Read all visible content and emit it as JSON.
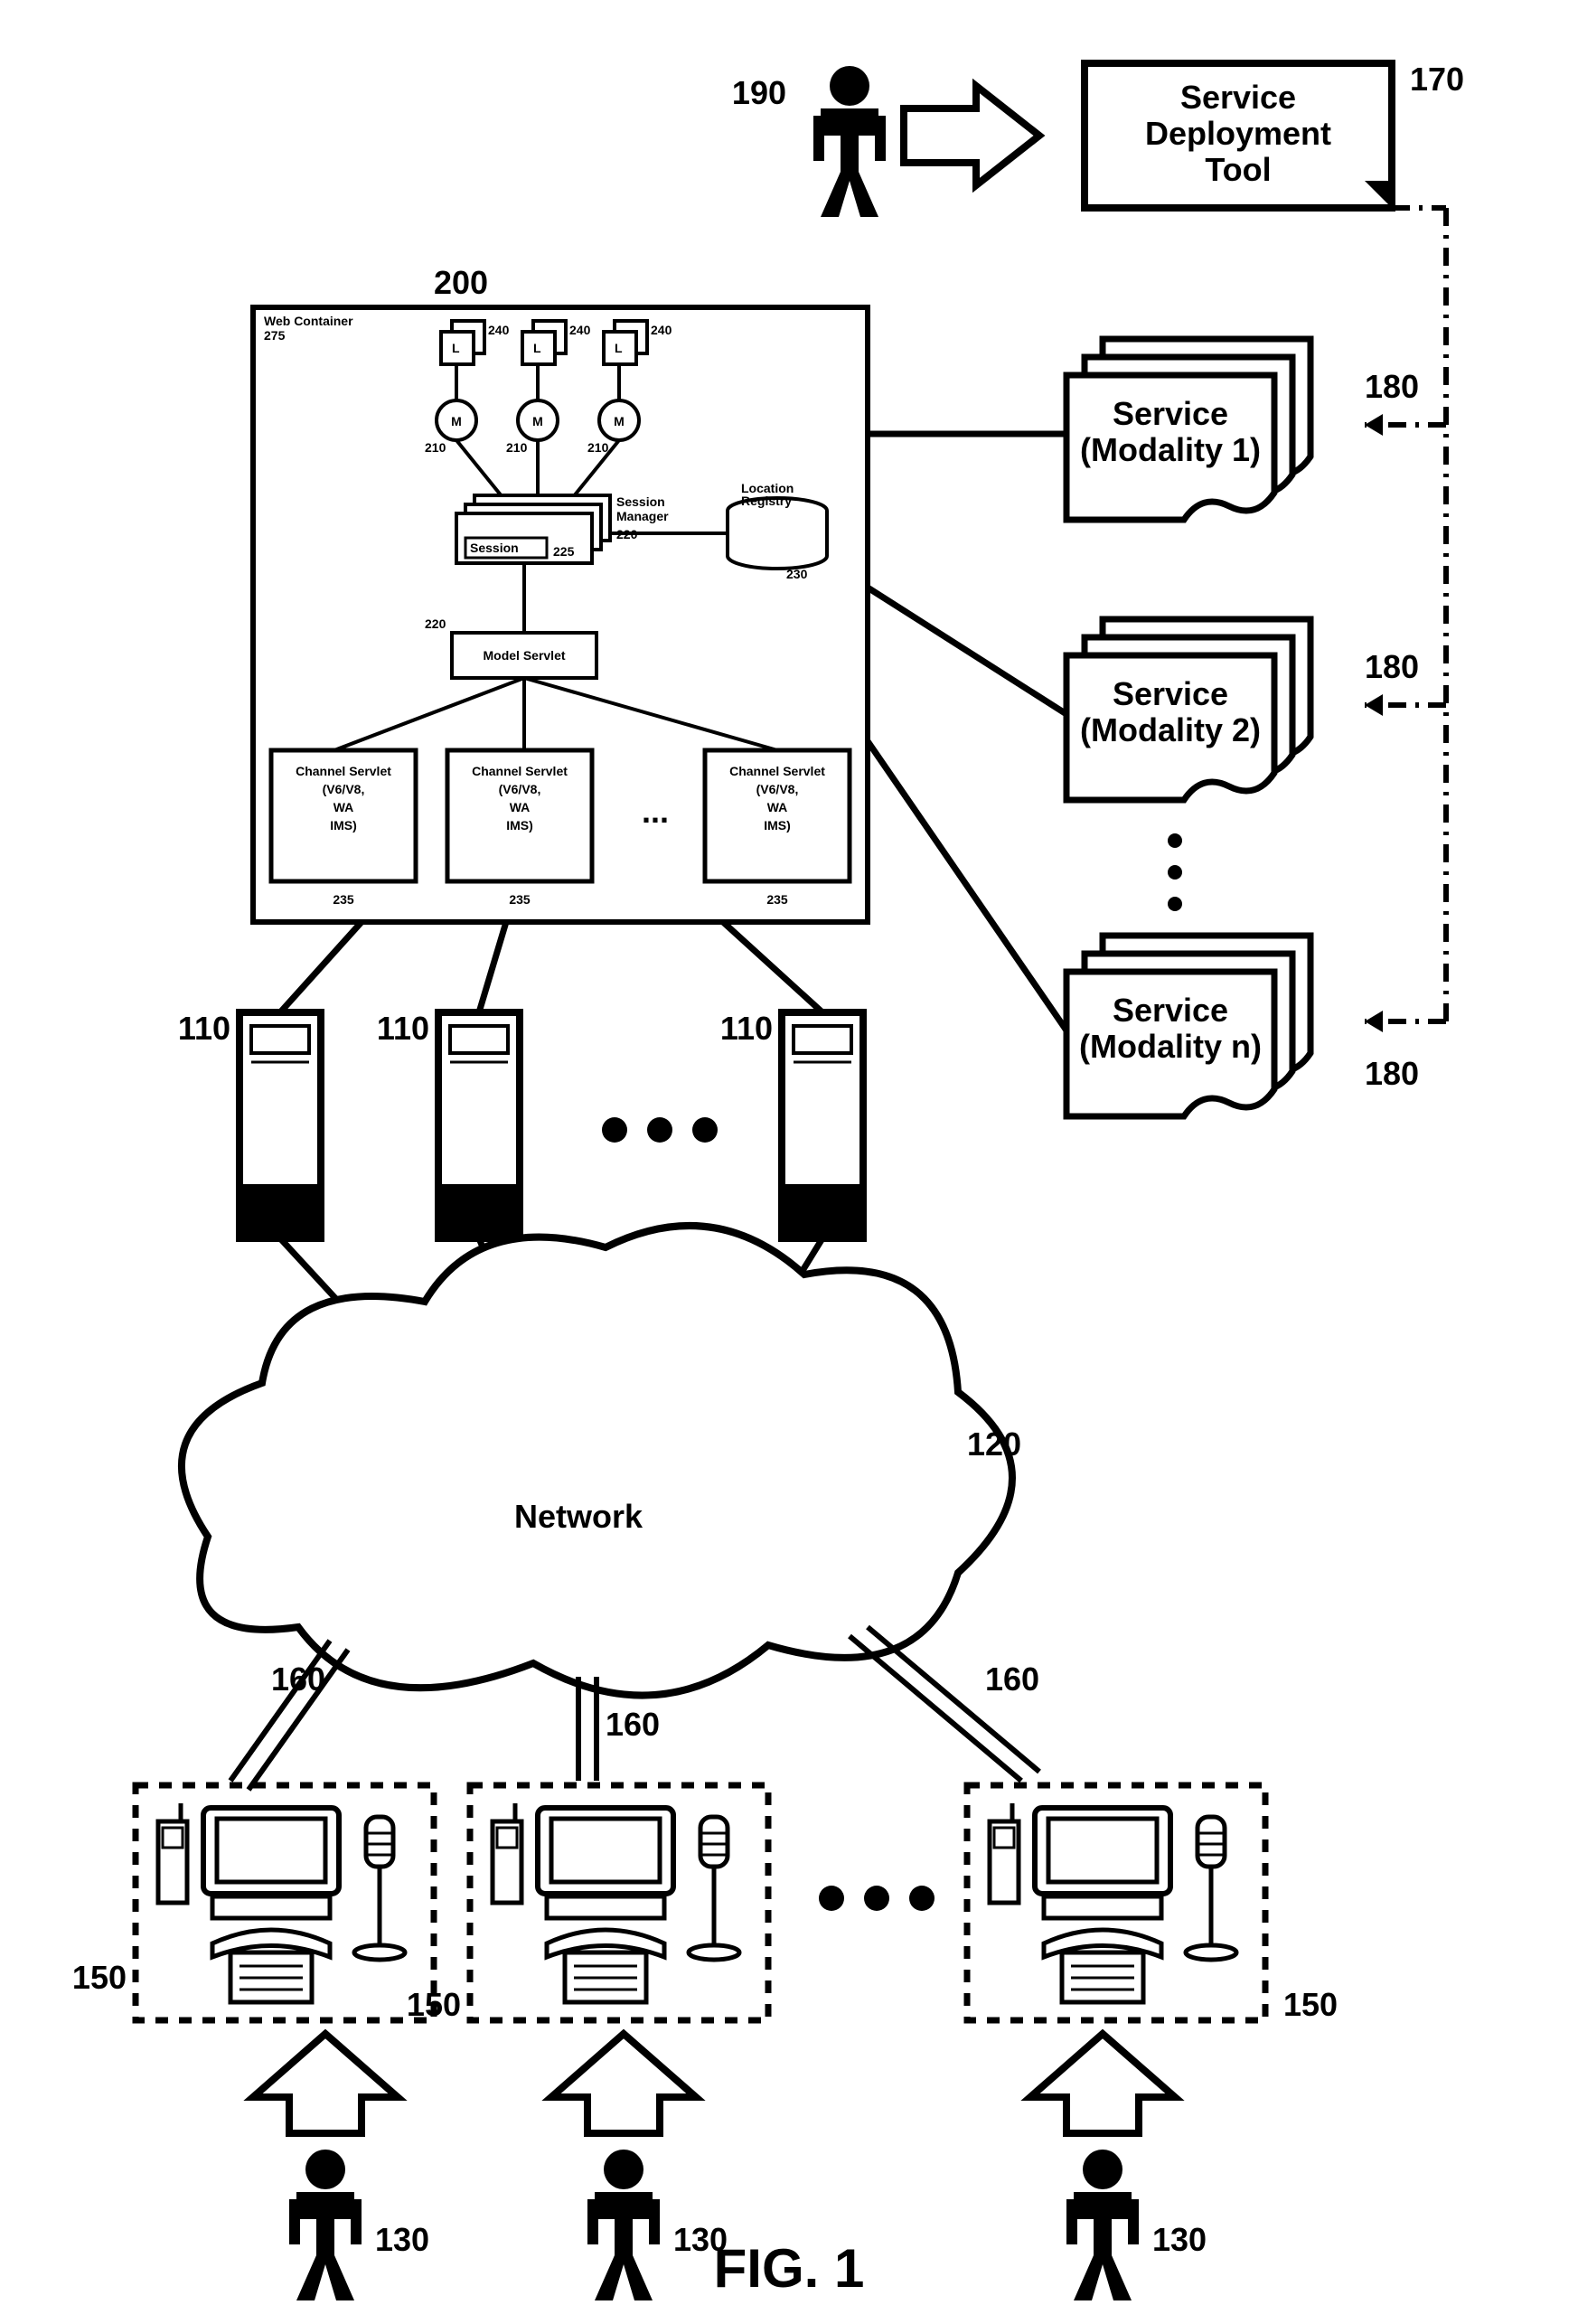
{
  "figure_label": "FIG. 1",
  "actor_top_ref": "190",
  "deploy_tool_ref": "170",
  "deploy_tool_lines": [
    "Service",
    "Deployment",
    "Tool"
  ],
  "web_container": {
    "ref": "200",
    "title": "Web Container",
    "title_ref": "275",
    "l_box_ref": "240",
    "l_box_label": "L",
    "m_circle_ref": "210",
    "m_circle_label": "M",
    "session_mgr": [
      "Session",
      "Manager"
    ],
    "session_mgr_ref": "220",
    "session_box": "Session",
    "session_box_ref": "225",
    "location_reg": [
      "Location",
      "Registry"
    ],
    "location_reg_ref": "230",
    "model_servlet": "Model Servlet",
    "model_servlet_ref": "220",
    "channel_servlet_lines": [
      "Channel Servlet",
      "(V6/V8,",
      "WA",
      "IMS)"
    ],
    "channel_servlet_ref": "235",
    "ellipsis": "..."
  },
  "service_docs": [
    {
      "lines": [
        "Service",
        "(Modality 1)"
      ],
      "ref": "180"
    },
    {
      "lines": [
        "Service",
        "(Modality 2)"
      ],
      "ref": "180"
    },
    {
      "lines": [
        "Service",
        "(Modality n)"
      ],
      "ref": "180"
    }
  ],
  "service_ellipsis": "ooo",
  "servers_ref": "110",
  "servers_ellipsis": "ooo",
  "network_label": "Network",
  "network_ref": "120",
  "client_conn_ref": "160",
  "client_box_ref": "150",
  "clients_ellipsis": "ooo",
  "user_ref": "130"
}
